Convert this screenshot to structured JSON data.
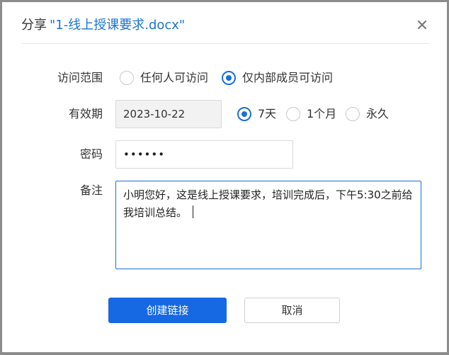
{
  "dialog": {
    "title_prefix": "分享",
    "file_name": "\"1-线上授课要求.docx\"",
    "close_icon": "close-icon"
  },
  "access": {
    "label": "访问范围",
    "options": [
      {
        "label": "任何人可访问",
        "checked": false
      },
      {
        "label": "仅内部成员可访问",
        "checked": true
      }
    ]
  },
  "validity": {
    "label": "有效期",
    "date_value": "2023-10-22",
    "options": [
      {
        "label": "7天",
        "checked": true
      },
      {
        "label": "1个月",
        "checked": false
      },
      {
        "label": "永久",
        "checked": false
      }
    ]
  },
  "password": {
    "label": "密码",
    "value": "••••••"
  },
  "note": {
    "label": "备注",
    "value": "小明您好，这是线上授课要求，培训完成后，下午5:30之前给我培训总结。"
  },
  "buttons": {
    "create": "创建链接",
    "cancel": "取消"
  },
  "colors": {
    "accent": "#1b6fd6",
    "primary_button": "#1668e3",
    "file_name": "#1b75d0"
  }
}
